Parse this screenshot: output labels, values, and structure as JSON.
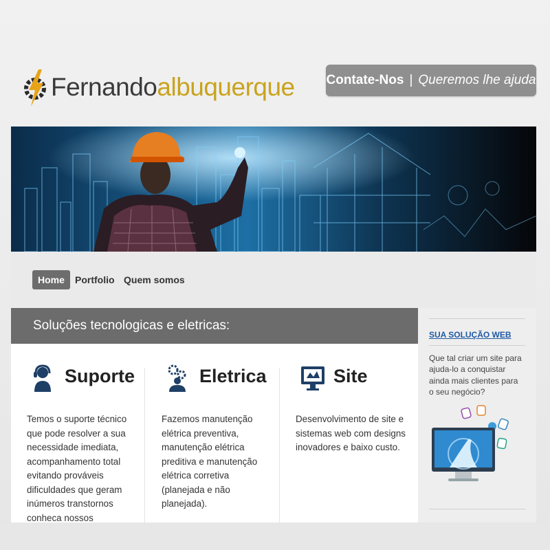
{
  "brand": {
    "logo_part1": "Fernando",
    "logo_part2": "albuquerque"
  },
  "contact": {
    "label": "Contate-Nos",
    "separator": "|",
    "tagline": "Queremos lhe ajuda"
  },
  "nav": {
    "items": [
      {
        "label": "Home",
        "active": true
      },
      {
        "label": "Portfolio",
        "active": false
      },
      {
        "label": "Quem somos",
        "active": false
      }
    ]
  },
  "main": {
    "header": "Soluções tecnologicas e eletricas:",
    "columns": [
      {
        "title": "Suporte",
        "icon": "support-headset-icon",
        "text": "Temos o suporte técnico que pode resolver a sua necessidade imediata, acompanhamento total evitando prováveis dificuldades que geram inúmeros transtornos conheca nossos servicos."
      },
      {
        "title": "Eletrica",
        "icon": "gears-person-icon",
        "text": "Fazemos manutenção elétrica preventiva, manutenção elétrica preditiva e manutenção elétrica corretiva (planejada e não planejada)."
      },
      {
        "title": "Site",
        "icon": "monitor-tools-icon",
        "text": "Desenvolvimento de site e sistemas web com designs inovadores e baixo custo."
      }
    ]
  },
  "sidebar": {
    "title": "SUA SOLUÇÃO WEB",
    "text": "Que tal criar um site para ajuda-lo a conquistar ainda mais clientes para o seu negócio?"
  },
  "colors": {
    "accent": "#c9a31d",
    "header_bg": "#6c6c6c",
    "link": "#1f5aa3",
    "icon": "#1e3f66"
  }
}
